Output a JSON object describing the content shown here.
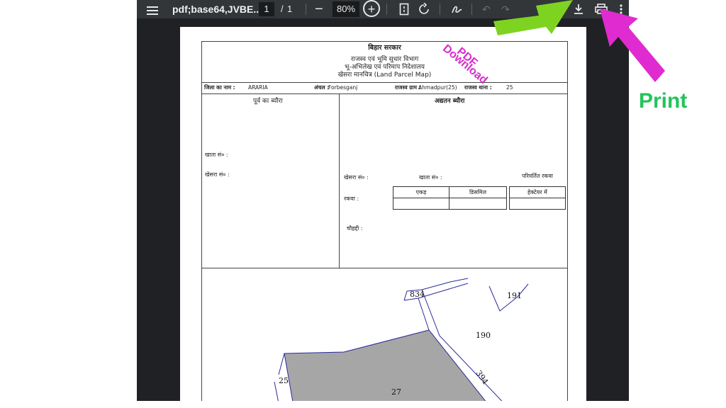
{
  "toolbar": {
    "title": "pdf;base64,JVBE...",
    "page_current": "1",
    "page_separator": "/",
    "page_total": "1",
    "zoom": "80%",
    "zoom_minus": "−",
    "zoom_plus": "+"
  },
  "document": {
    "header": {
      "govt": "बिहार सरकार",
      "dept": "राजस्व एवं भूमि सुधार विभाग",
      "directorate": "भू-अभिलेख एवं परिमाप निदेशालय",
      "map_title": "खेसरा मानचित्र (Land Parcel Map)"
    },
    "info": {
      "district_label": "जिला का नाम :",
      "district_value": "ARARIA",
      "circle_label": "अंचल :",
      "circle_value": "Forbesganj",
      "village_label": "राजस्व ग्राम :",
      "village_value": "Ahmadpur(25)",
      "thana_label": "राजस्व थाना :",
      "thana_value": "25"
    },
    "left_col": {
      "heading": "पूर्व का ब्यौरा",
      "khata": "खाता सं० :",
      "khesra": "खेसरा सं० :"
    },
    "right_col": {
      "heading": "अद्यतन ब्यौरा",
      "khesra": "खेसरा सं० :",
      "khata": "खाता सं० :",
      "changed_area": "परिवर्तित रकवा",
      "rakba": "रकवा :",
      "acre": "एकड़",
      "decimal": "डिसमिल",
      "hectare": "हेक्टेयर में",
      "chauhaddi": "चौहद्दी :"
    },
    "map_labels": {
      "p834": "834",
      "p191": "191",
      "p190": "190",
      "p394": "394",
      "p25": "25",
      "p27": "27"
    }
  },
  "annotations": {
    "download": "Download",
    "pdf": "PDF",
    "print": "Print",
    "download_arrow_color": "#7ed321",
    "print_arrow_color": "#e02bd0"
  }
}
